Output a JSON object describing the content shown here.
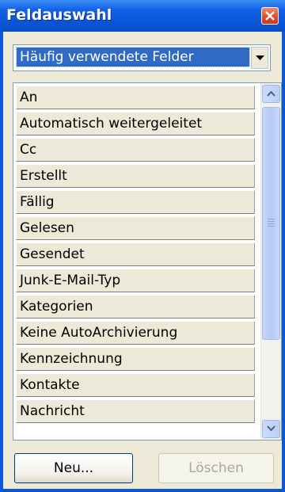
{
  "window": {
    "title": "Feldauswahl"
  },
  "dropdown": {
    "selected": "Häufig verwendete Felder"
  },
  "fields": [
    "An",
    "Automatisch weitergeleitet",
    "Cc",
    "Erstellt",
    "Fällig",
    "Gelesen",
    "Gesendet",
    "Junk-E-Mail-Typ",
    "Kategorien",
    "Keine AutoArchivierung",
    "Kennzeichnung",
    "Kontakte",
    "Nachricht"
  ],
  "buttons": {
    "new_label": "Neu...",
    "delete_label": "Löschen"
  },
  "colors": {
    "title_bar": "#0a55d6",
    "selection": "#316ac5",
    "close": "#e0492a"
  }
}
